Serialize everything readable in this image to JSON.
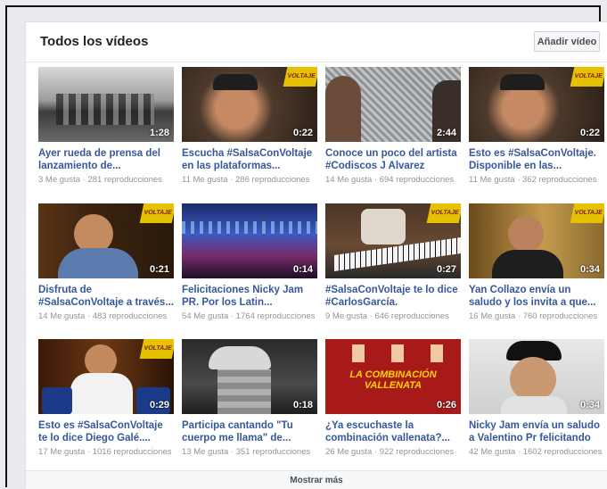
{
  "header": {
    "title": "Todos los vídeos",
    "add_label": "Añadir vídeo"
  },
  "videos": [
    {
      "title": "Ayer rueda de prensa del lanzamiento de...",
      "meta": "3 Me gusta · 281 reproducciones",
      "duration": "1:28"
    },
    {
      "title": "Escucha #SalsaConVoltaje en las plataformas...",
      "meta": "11 Me gusta · 286 reproducciones",
      "duration": "0:22"
    },
    {
      "title": "Conoce un poco del artista #Codiscos J Alvarez",
      "meta": "14 Me gusta · 694 reproducciones",
      "duration": "2:44"
    },
    {
      "title": "Esto es #SalsaConVoltaje. Disponible en las...",
      "meta": "11 Me gusta · 362 reproducciones",
      "duration": "0:22"
    },
    {
      "title": "Disfruta de #SalsaConVoltaje a través...",
      "meta": "14 Me gusta · 483 reproducciones",
      "duration": "0:21"
    },
    {
      "title": "Felicitaciones Nicky Jam PR. Por los Latin...",
      "meta": "54 Me gusta · 1764 reproducciones",
      "duration": "0:14"
    },
    {
      "title": "#SalsaConVoltaje te lo dice #CarlosGarcía. Disponible...",
      "meta": "9 Me gusta · 646 reproducciones",
      "duration": "0:27"
    },
    {
      "title": "Yan Collazo envía un saludo y los invita a que...",
      "meta": "16 Me gusta · 760 reproducciones",
      "duration": "0:34"
    },
    {
      "title": "Esto es #SalsaConVoltaje te lo dice Diego Galé....",
      "meta": "17 Me gusta · 1016 reproducciones",
      "duration": "0:29"
    },
    {
      "title": "Participa cantando \"Tu cuerpo me llama\" de...",
      "meta": "13 Me gusta · 351 reproducciones",
      "duration": "0:18"
    },
    {
      "title": "¿Ya escuchaste la combinación vallenata?...",
      "meta": "26 Me gusta · 922 reproducciones",
      "duration": "0:26"
    },
    {
      "title": "Nicky Jam envía un saludo a Valentino Pr felicitando su...",
      "meta": "42 Me gusta · 1602 reproducciones",
      "duration": "0:34"
    }
  ],
  "footer": {
    "more_label": "Mostrar más"
  },
  "thumb_text": {
    "badge": "VOLTAJE",
    "vallenata": "LA COMBINACIÓN VALLENATA"
  },
  "colors": {
    "link": "#365899",
    "meta": "#90949c",
    "badge": "#e6c100"
  }
}
